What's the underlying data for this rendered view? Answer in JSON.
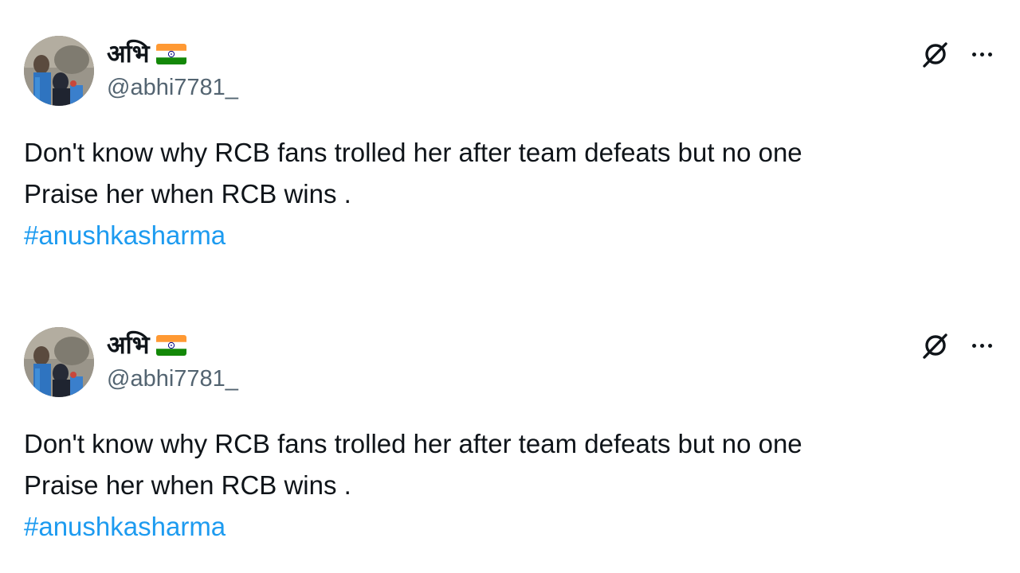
{
  "colors": {
    "text": "#0f1419",
    "secondary": "#536471",
    "link": "#1d9bf0",
    "background": "#ffffff"
  },
  "tweets": [
    {
      "author": {
        "display_name": "अभि",
        "handle": "@abhi7781_",
        "flag": "india-flag-icon",
        "avatar": "avatar-photo"
      },
      "text_lines": [
        "Don't know why RCB fans trolled her after team defeats but no one",
        "Praise her when RCB wins ."
      ],
      "hashtag": "#anushkasharma",
      "icons": {
        "grok": "grok-icon",
        "more": "more-options-icon"
      }
    },
    {
      "author": {
        "display_name": "अभि",
        "handle": "@abhi7781_",
        "flag": "india-flag-icon",
        "avatar": "avatar-photo"
      },
      "text_lines": [
        "Don't know why RCB fans trolled her after team defeats but no one",
        "Praise her when RCB wins ."
      ],
      "hashtag": "#anushkasharma",
      "icons": {
        "grok": "grok-icon",
        "more": "more-options-icon"
      }
    }
  ]
}
